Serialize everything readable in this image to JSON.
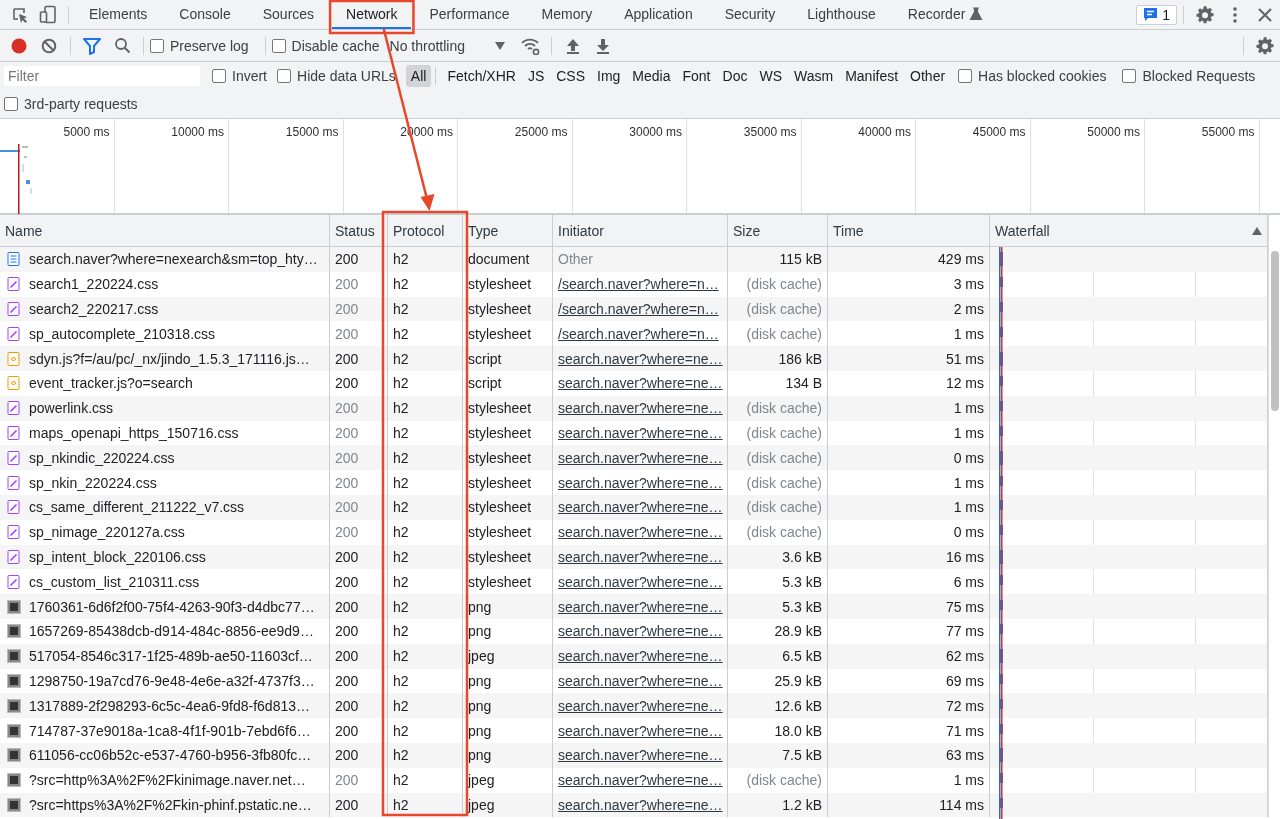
{
  "tabs": [
    {
      "label": "Elements",
      "selected": false
    },
    {
      "label": "Console",
      "selected": false
    },
    {
      "label": "Sources",
      "selected": false
    },
    {
      "label": "Network",
      "selected": true
    },
    {
      "label": "Performance",
      "selected": false
    },
    {
      "label": "Memory",
      "selected": false
    },
    {
      "label": "Application",
      "selected": false
    },
    {
      "label": "Security",
      "selected": false
    },
    {
      "label": "Lighthouse",
      "selected": false
    },
    {
      "label": "Recorder",
      "selected": false,
      "experimental": true
    }
  ],
  "issues_badge": "1",
  "toolbar": {
    "recording": true,
    "filter_active": true,
    "checkboxes": [
      {
        "label": "Preserve log",
        "checked": false
      },
      {
        "label": "Disable cache",
        "checked": false
      }
    ],
    "throttling": "No throttling"
  },
  "filter_bar": {
    "placeholder": "Filter",
    "options": [
      {
        "label": "Invert",
        "checked": false
      },
      {
        "label": "Hide data URLs",
        "checked": false
      }
    ],
    "types": [
      {
        "label": "All",
        "selected": true
      },
      {
        "label": "Fetch/XHR",
        "selected": false
      },
      {
        "label": "JS",
        "selected": false
      },
      {
        "label": "CSS",
        "selected": false
      },
      {
        "label": "Img",
        "selected": false
      },
      {
        "label": "Media",
        "selected": false
      },
      {
        "label": "Font",
        "selected": false
      },
      {
        "label": "Doc",
        "selected": false
      },
      {
        "label": "WS",
        "selected": false
      },
      {
        "label": "Wasm",
        "selected": false
      },
      {
        "label": "Manifest",
        "selected": false
      },
      {
        "label": "Other",
        "selected": false
      }
    ],
    "extra": [
      {
        "label": "Has blocked cookies",
        "checked": false
      },
      {
        "label": "Blocked Requests",
        "checked": false
      }
    ],
    "second_row": [
      {
        "label": "3rd-party requests",
        "checked": false
      }
    ]
  },
  "overview": {
    "ticks": [
      "5000 ms",
      "10000 ms",
      "15000 ms",
      "20000 ms",
      "25000 ms",
      "30000 ms",
      "35000 ms",
      "40000 ms",
      "45000 ms",
      "50000 ms",
      "55000 ms"
    ]
  },
  "table": {
    "columns": [
      {
        "label": "Name",
        "highlighted": false
      },
      {
        "label": "Status",
        "highlighted": false
      },
      {
        "label": "Protocol",
        "highlighted": true
      },
      {
        "label": "Type",
        "highlighted": false
      },
      {
        "label": "Initiator",
        "highlighted": false
      },
      {
        "label": "Size",
        "highlighted": false
      },
      {
        "label": "Time",
        "highlighted": false
      },
      {
        "label": "Waterfall",
        "highlighted": false,
        "sorted": true
      }
    ],
    "rows": [
      {
        "kind": "document",
        "name": "search.naver?where=nexearch&sm=top_hty…",
        "status": "200",
        "cached": false,
        "protocol": "h2",
        "type": "document",
        "initiator": "Other",
        "initiator_link": false,
        "size": "115 kB",
        "time": "429 ms"
      },
      {
        "kind": "stylesheet",
        "name": "search1_220224.css",
        "status": "200",
        "cached": true,
        "protocol": "h2",
        "type": "stylesheet",
        "initiator": "/search.naver?where=n…",
        "initiator_link": true,
        "size": "(disk cache)",
        "time": "3 ms"
      },
      {
        "kind": "stylesheet",
        "name": "search2_220217.css",
        "status": "200",
        "cached": true,
        "protocol": "h2",
        "type": "stylesheet",
        "initiator": "/search.naver?where=n…",
        "initiator_link": true,
        "size": "(disk cache)",
        "time": "2 ms"
      },
      {
        "kind": "stylesheet",
        "name": "sp_autocomplete_210318.css",
        "status": "200",
        "cached": true,
        "protocol": "h2",
        "type": "stylesheet",
        "initiator": "/search.naver?where=n…",
        "initiator_link": true,
        "size": "(disk cache)",
        "time": "1 ms"
      },
      {
        "kind": "script",
        "name": "sdyn.js?f=/au/pc/_nx/jindo_1.5.3_171116.js…",
        "status": "200",
        "cached": false,
        "protocol": "h2",
        "type": "script",
        "initiator": "search.naver?where=ne…",
        "initiator_link": true,
        "size": "186 kB",
        "time": "51 ms"
      },
      {
        "kind": "script",
        "name": "event_tracker.js?o=search",
        "status": "200",
        "cached": false,
        "protocol": "h2",
        "type": "script",
        "initiator": "search.naver?where=ne…",
        "initiator_link": true,
        "size": "134 B",
        "time": "12 ms"
      },
      {
        "kind": "stylesheet",
        "name": "powerlink.css",
        "status": "200",
        "cached": true,
        "protocol": "h2",
        "type": "stylesheet",
        "initiator": "search.naver?where=ne…",
        "initiator_link": true,
        "size": "(disk cache)",
        "time": "1 ms"
      },
      {
        "kind": "stylesheet",
        "name": "maps_openapi_https_150716.css",
        "status": "200",
        "cached": true,
        "protocol": "h2",
        "type": "stylesheet",
        "initiator": "search.naver?where=ne…",
        "initiator_link": true,
        "size": "(disk cache)",
        "time": "1 ms"
      },
      {
        "kind": "stylesheet",
        "name": "sp_nkindic_220224.css",
        "status": "200",
        "cached": true,
        "protocol": "h2",
        "type": "stylesheet",
        "initiator": "search.naver?where=ne…",
        "initiator_link": true,
        "size": "(disk cache)",
        "time": "0 ms"
      },
      {
        "kind": "stylesheet",
        "name": "sp_nkin_220224.css",
        "status": "200",
        "cached": true,
        "protocol": "h2",
        "type": "stylesheet",
        "initiator": "search.naver?where=ne…",
        "initiator_link": true,
        "size": "(disk cache)",
        "time": "1 ms"
      },
      {
        "kind": "stylesheet",
        "name": "cs_same_different_211222_v7.css",
        "status": "200",
        "cached": true,
        "protocol": "h2",
        "type": "stylesheet",
        "initiator": "search.naver?where=ne…",
        "initiator_link": true,
        "size": "(disk cache)",
        "time": "1 ms"
      },
      {
        "kind": "stylesheet",
        "name": "sp_nimage_220127a.css",
        "status": "200",
        "cached": true,
        "protocol": "h2",
        "type": "stylesheet",
        "initiator": "search.naver?where=ne…",
        "initiator_link": true,
        "size": "(disk cache)",
        "time": "0 ms"
      },
      {
        "kind": "stylesheet",
        "name": "sp_intent_block_220106.css",
        "status": "200",
        "cached": false,
        "protocol": "h2",
        "type": "stylesheet",
        "initiator": "search.naver?where=ne…",
        "initiator_link": true,
        "size": "3.6 kB",
        "time": "16 ms"
      },
      {
        "kind": "stylesheet",
        "name": "cs_custom_list_210311.css",
        "status": "200",
        "cached": false,
        "protocol": "h2",
        "type": "stylesheet",
        "initiator": "search.naver?where=ne…",
        "initiator_link": true,
        "size": "5.3 kB",
        "time": "6 ms"
      },
      {
        "kind": "image",
        "name": "1760361-6d6f2f00-75f4-4263-90f3-d4dbc77…",
        "status": "200",
        "cached": false,
        "protocol": "h2",
        "type": "png",
        "initiator": "search.naver?where=ne…",
        "initiator_link": true,
        "size": "5.3 kB",
        "time": "75 ms"
      },
      {
        "kind": "image",
        "name": "1657269-85438dcb-d914-484c-8856-ee9d9…",
        "status": "200",
        "cached": false,
        "protocol": "h2",
        "type": "png",
        "initiator": "search.naver?where=ne…",
        "initiator_link": true,
        "size": "28.9 kB",
        "time": "77 ms"
      },
      {
        "kind": "image",
        "name": "517054-8546c317-1f25-489b-ae50-11603cf…",
        "status": "200",
        "cached": false,
        "protocol": "h2",
        "type": "jpeg",
        "initiator": "search.naver?where=ne…",
        "initiator_link": true,
        "size": "6.5 kB",
        "time": "62 ms"
      },
      {
        "kind": "image",
        "name": "1298750-19a7cd76-9e48-4e6e-a32f-4737f3…",
        "status": "200",
        "cached": false,
        "protocol": "h2",
        "type": "png",
        "initiator": "search.naver?where=ne…",
        "initiator_link": true,
        "size": "25.9 kB",
        "time": "69 ms"
      },
      {
        "kind": "image",
        "name": "1317889-2f298293-6c5c-4ea6-9fd8-f6d813…",
        "status": "200",
        "cached": false,
        "protocol": "h2",
        "type": "png",
        "initiator": "search.naver?where=ne…",
        "initiator_link": true,
        "size": "12.6 kB",
        "time": "72 ms"
      },
      {
        "kind": "image",
        "name": "714787-37e9018a-1ca8-4f1f-901b-7ebd6f6…",
        "status": "200",
        "cached": false,
        "protocol": "h2",
        "type": "png",
        "initiator": "search.naver?where=ne…",
        "initiator_link": true,
        "size": "18.0 kB",
        "time": "71 ms"
      },
      {
        "kind": "image",
        "name": "611056-cc06b52c-e537-4760-b956-3fb80fc…",
        "status": "200",
        "cached": false,
        "protocol": "h2",
        "type": "png",
        "initiator": "search.naver?where=ne…",
        "initiator_link": true,
        "size": "7.5 kB",
        "time": "63 ms"
      },
      {
        "kind": "image",
        "name": "?src=http%3A%2F%2Fkinimage.naver.net…",
        "status": "200",
        "cached": true,
        "protocol": "h2",
        "type": "jpeg",
        "initiator": "search.naver?where=ne…",
        "initiator_link": true,
        "size": "(disk cache)",
        "time": "1 ms"
      },
      {
        "kind": "image",
        "name": "?src=https%3A%2F%2Fkin-phinf.pstatic.ne…",
        "status": "200",
        "cached": false,
        "protocol": "h2",
        "type": "jpeg",
        "initiator": "search.naver?where=ne…",
        "initiator_link": true,
        "size": "1.2 kB",
        "time": "114 ms"
      }
    ]
  }
}
